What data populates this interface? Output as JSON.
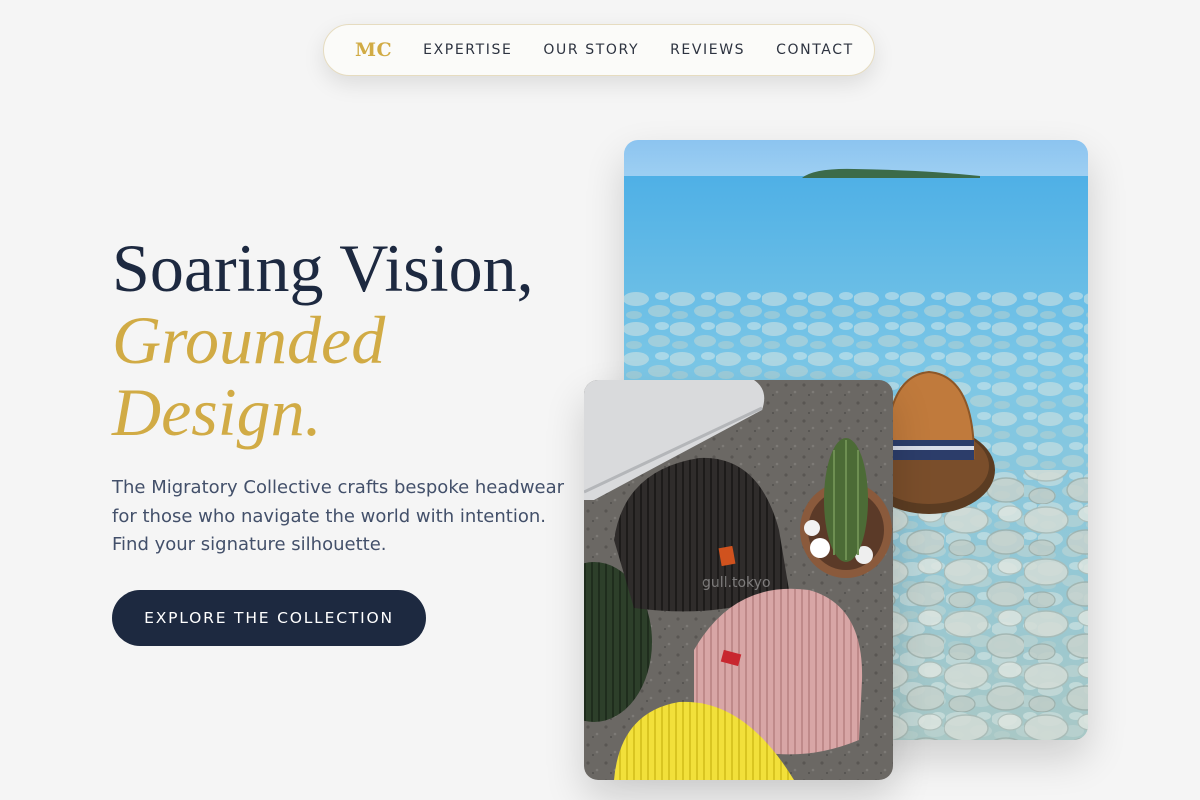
{
  "nav": {
    "logo": "MC",
    "links": [
      "EXPERTISE",
      "OUR STORY",
      "REVIEWS",
      "CONTACT"
    ]
  },
  "hero": {
    "headline_line1": "Soaring Vision,",
    "headline_accent_line1": "Grounded",
    "headline_accent_line2": "Design.",
    "subtext": "The Migratory Collective crafts bespoke headwear for those who navigate the world with intention. Find your signature silhouette.",
    "cta_label": "EXPLORE THE COLLECTION"
  },
  "images": {
    "beanie_watermark": "gull.tokyo"
  },
  "colors": {
    "accent_gold": "#d1ab45",
    "navy": "#1d2940",
    "background": "#f5f5f5"
  }
}
